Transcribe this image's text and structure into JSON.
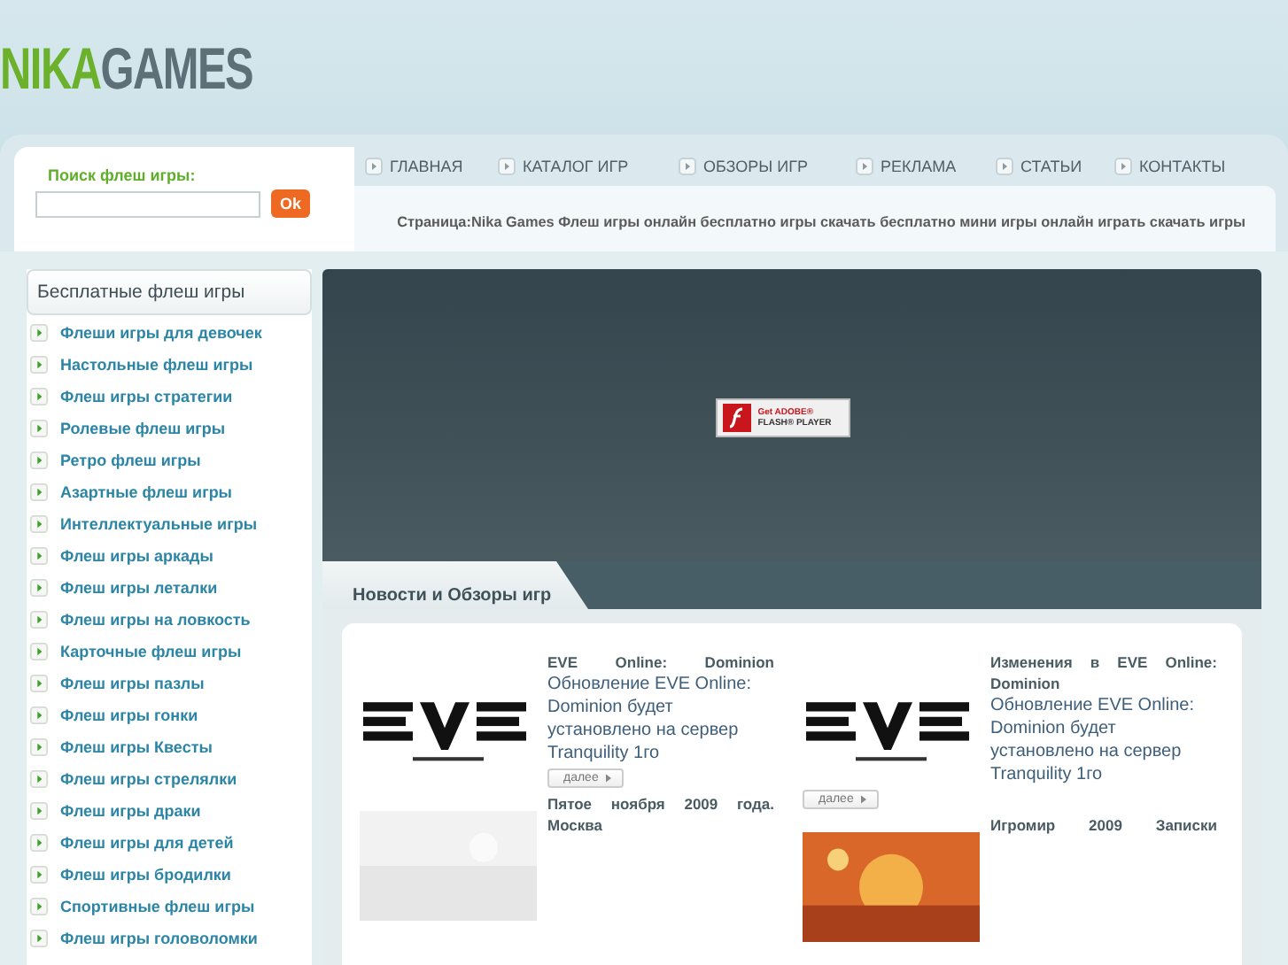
{
  "logo": {
    "part_1": "NIKA",
    "part_2": "GAMES"
  },
  "search": {
    "label": "Поиск флеш игры:",
    "button": "Ok"
  },
  "nav": [
    "ГЛАВНАЯ",
    "КАТАЛОГ ИГР",
    "ОБЗОРЫ ИГР",
    "РЕКЛАМА",
    "СТАТЬИ",
    "КОНТАКТЫ"
  ],
  "breadcrumb": "Страница:Nika Games Флеш игры онлайн бесплатно игры скачать бесплатно мини игры онлайн играть скачать игры",
  "sidebar": {
    "title": "Бесплатные флеш игры",
    "items": [
      "Флеши игры для девочек",
      "Настольные флеш игры",
      "Флеш игры стратегии",
      "Ролевые флеш игры",
      "Ретро флеш игры",
      "Азартные флеш игры",
      "Интеллектуальные игры",
      "Флеш игры аркады",
      "Флеш игры леталки",
      "Флеш игры на ловкость",
      "Карточные флеш игры",
      "Флеш игры пазлы",
      "Флеш игры гонки",
      "Флеш игры Квесты",
      "Флеш игры стрелялки",
      "Флеш игры драки",
      "Флеш игры для детей",
      "Флеш игры бродилки",
      "Спортивные флеш игры",
      "Флеш игры головоломки"
    ]
  },
  "flash": {
    "line_1": "Get ADOBE®",
    "line_2": "FLASH® PLAYER"
  },
  "news": {
    "title": "Новости и Обзоры игр",
    "columns": [
      [
        {
          "title": "EVE Online: Dominion",
          "text": "Обновление EVE Online: Dominion будет установлено на сервер Tranquility 1го",
          "more": "далее"
        },
        {
          "title": "Пятое ноября 2009 года. Москва"
        }
      ],
      [
        {
          "title": "Изменения в EVE Online: Dominion",
          "text": "Обновление EVE Online: Dominion будет установлено на сервер Tranquility 1го",
          "more": "далее"
        },
        {
          "title": "Игромир 2009 Записки"
        }
      ]
    ]
  }
}
